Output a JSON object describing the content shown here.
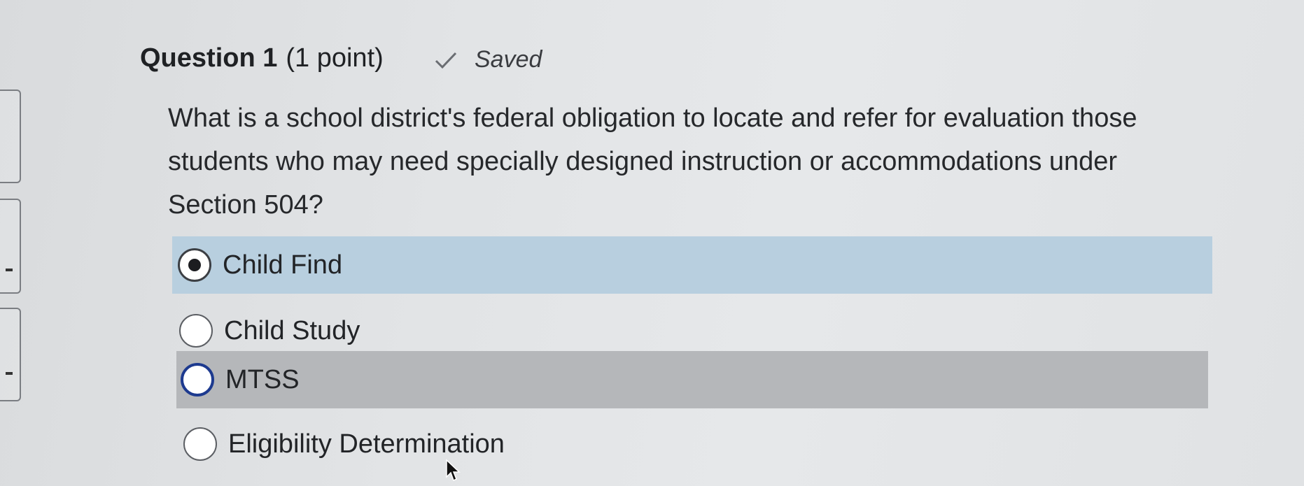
{
  "question": {
    "title": "Question 1",
    "points": "(1 point)",
    "status": "Saved",
    "status_icon": "check-icon",
    "text": "What is a school district's federal obligation to locate and refer for evaluation those students who may need specially designed instruction or accommodations under Section 504?"
  },
  "options": [
    {
      "label": "Child Find",
      "selected": true
    },
    {
      "label": "Child Study",
      "selected": false
    },
    {
      "label": "MTSS",
      "selected": false,
      "focused": true
    },
    {
      "label": "Eligibility Determination",
      "selected": false
    }
  ],
  "colors": {
    "selected_row": "#b8cfdf",
    "hover_row": "#b5b7ba",
    "focus_ring": "#1d3a8f"
  }
}
